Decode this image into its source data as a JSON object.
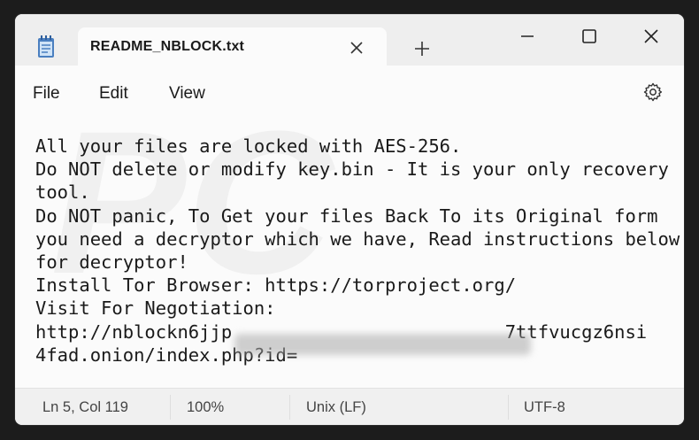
{
  "tab": {
    "title": "README_NBLOCK.txt"
  },
  "menu": {
    "file": "File",
    "edit": "Edit",
    "view": "View"
  },
  "editor": {
    "lines": [
      "All your files are locked with AES-256.",
      "Do NOT delete or modify key.bin - It is your only recovery",
      "tool.",
      "Do NOT panic, To Get your files Back To its Original form",
      "you need a decryptor which we have, Read instructions below",
      "for decryptor!",
      "Install Tor Browser: https://torproject.org/",
      "Visit For Negotiation:",
      "http://nblockn6jjp                         7ttfvucgz6nsi",
      "4fad.onion/index.php?id="
    ]
  },
  "status": {
    "position": "Ln 5, Col 119",
    "zoom": "100%",
    "line_ending": "Unix (LF)",
    "encoding": "UTF-8"
  },
  "watermark": "PC"
}
